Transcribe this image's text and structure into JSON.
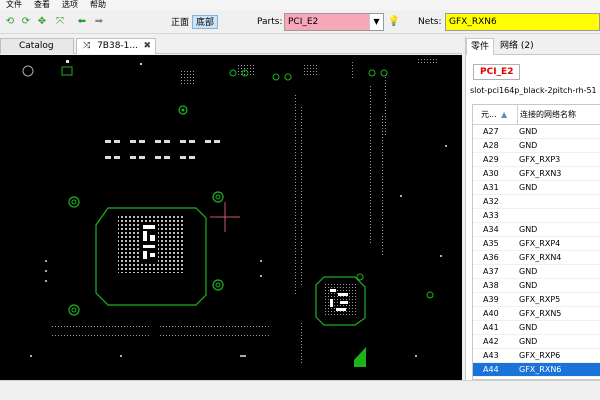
{
  "menu": [
    "文件",
    "查看",
    "选项",
    "帮助"
  ],
  "toolbar": {
    "front_label": "正面",
    "bottom_label": "底部",
    "parts_label": "Parts:",
    "parts_value": "PCI_E2",
    "nets_label": "Nets:",
    "nets_value": "GFX_RXN6"
  },
  "tabs": {
    "catalog": "Catalog",
    "board": "7B38-1...",
    "board_close": "✖",
    "board_icon": "⤨"
  },
  "right_panel": {
    "tab_parts": "零件",
    "tab_nets": "网络 (2)",
    "part_name": "PCI_E2",
    "footprint": "slot-pci164p_black-2pitch-rh-51",
    "col_pin": "元...",
    "col_net": "连接的网络名称",
    "rows": [
      {
        "pin": "A27",
        "net": "GND"
      },
      {
        "pin": "A28",
        "net": "GND"
      },
      {
        "pin": "A29",
        "net": "GFX_RXP3"
      },
      {
        "pin": "A30",
        "net": "GFX_RXN3"
      },
      {
        "pin": "A31",
        "net": "GND"
      },
      {
        "pin": "A32",
        "net": ""
      },
      {
        "pin": "A33",
        "net": ""
      },
      {
        "pin": "A34",
        "net": "GND"
      },
      {
        "pin": "A35",
        "net": "GFX_RXP4"
      },
      {
        "pin": "A36",
        "net": "GFX_RXN4"
      },
      {
        "pin": "A37",
        "net": "GND"
      },
      {
        "pin": "A38",
        "net": "GND"
      },
      {
        "pin": "A39",
        "net": "GFX_RXP5"
      },
      {
        "pin": "A40",
        "net": "GFX_RXN5"
      },
      {
        "pin": "A41",
        "net": "GND"
      },
      {
        "pin": "A42",
        "net": "GND"
      },
      {
        "pin": "A43",
        "net": "GFX_RXP6"
      },
      {
        "pin": "A44",
        "net": "GFX_RXN6"
      }
    ],
    "selected_pin": "A44"
  },
  "colors": {
    "parts_bg": "#f7a8b8",
    "nets_bg": "#ffff00",
    "canvas_bg": "#000000",
    "trace_green": "#1db31d",
    "selection": "#1a73d9",
    "part_red": "#e00000"
  },
  "icons": [
    "refresh-left-icon",
    "refresh-right-icon",
    "grid-icon",
    "zoom-fit-icon",
    "arrow-left-icon",
    "arrow-right-icon",
    "dropdown-icon",
    "bulb-icon",
    "sort-up-icon"
  ]
}
